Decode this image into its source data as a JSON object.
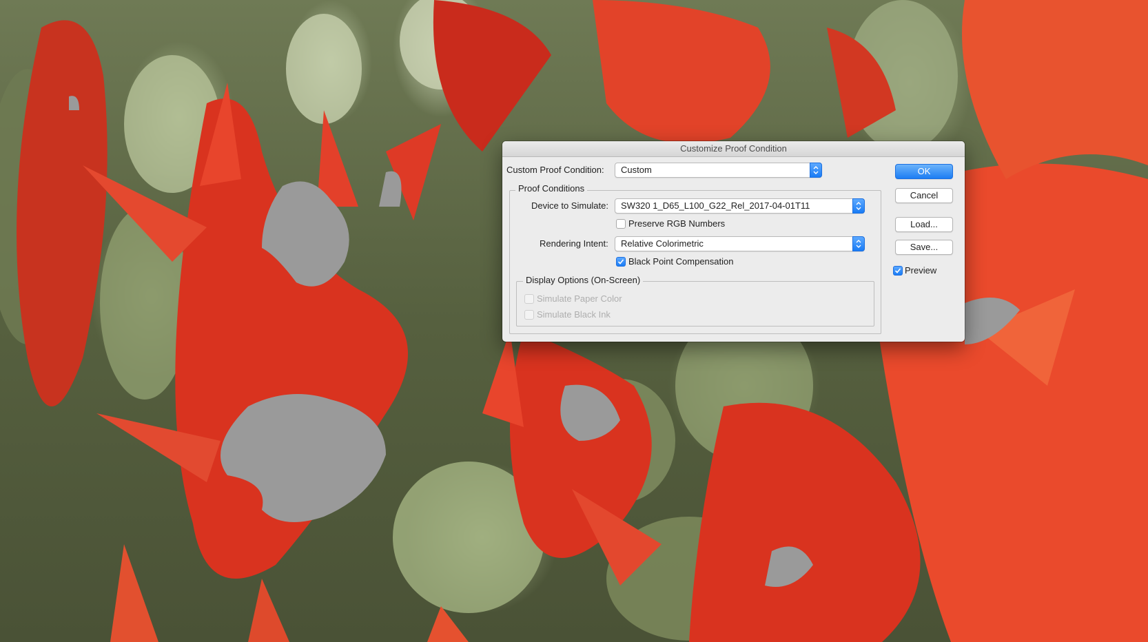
{
  "dialog": {
    "title": "Customize Proof Condition",
    "custom_proof_condition": {
      "label": "Custom Proof Condition:",
      "value": "Custom"
    },
    "proof_conditions": {
      "group_title": "Proof Conditions",
      "device_to_simulate": {
        "label": "Device to Simulate:",
        "value": "SW320 1_D65_L100_G22_Rel_2017-04-01T11"
      },
      "preserve_rgb": {
        "label": "Preserve RGB Numbers",
        "checked": false
      },
      "rendering_intent": {
        "label": "Rendering Intent:",
        "value": "Relative Colorimetric"
      },
      "black_point_compensation": {
        "label": "Black Point Compensation",
        "checked": true
      }
    },
    "display_options": {
      "group_title": "Display Options (On-Screen)",
      "simulate_paper_color": {
        "label": "Simulate Paper Color",
        "checked": false,
        "enabled": false
      },
      "simulate_black_ink": {
        "label": "Simulate Black Ink",
        "checked": false,
        "enabled": false
      }
    },
    "buttons": {
      "ok": "OK",
      "cancel": "Cancel",
      "load": "Load...",
      "save": "Save..."
    },
    "preview": {
      "label": "Preview",
      "checked": true
    }
  },
  "colors": {
    "accent": "#1a7cf5",
    "flower_red": "#e02a1c",
    "gamut_warning_gray": "#9a9a9a"
  }
}
